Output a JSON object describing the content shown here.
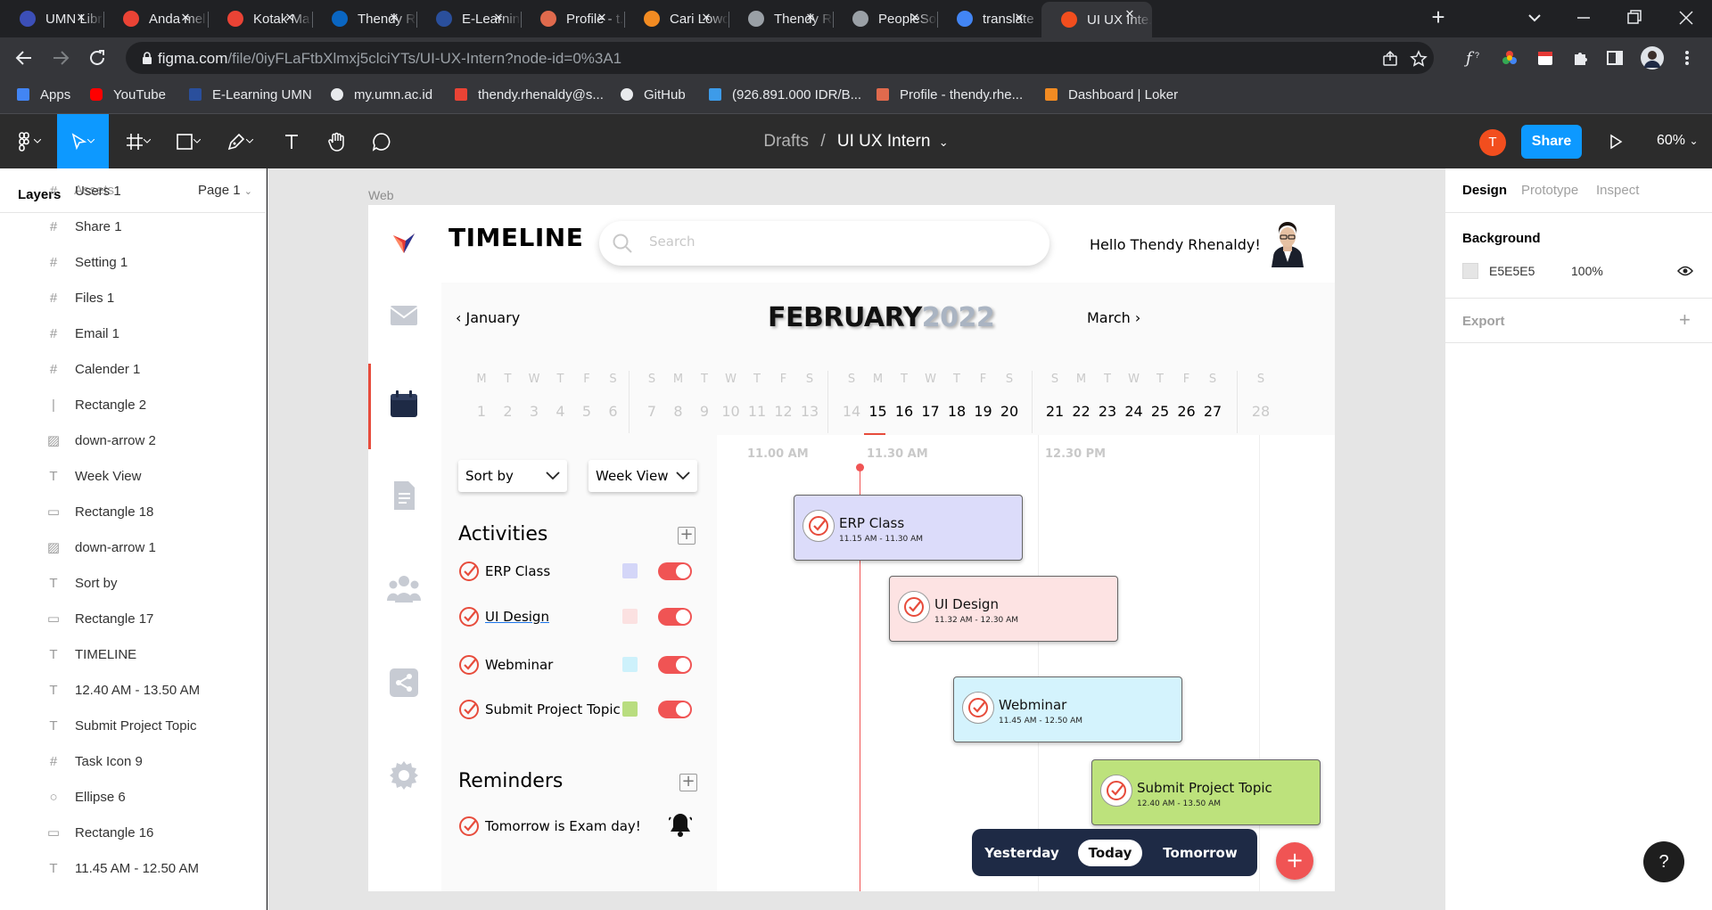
{
  "browser": {
    "tabs": [
      {
        "title": "UMN Library",
        "favicon": "globe-icon",
        "color": "#3c4fb8"
      },
      {
        "title": "Anda mel...",
        "favicon": "gmail-icon",
        "color": "#ea4335"
      },
      {
        "title": "Kotak Ma...",
        "favicon": "gmail-icon",
        "color": "#ea4335"
      },
      {
        "title": "Thendy R...",
        "favicon": "linkedin-icon",
        "color": "#0a66c2"
      },
      {
        "title": "E-Learnin...",
        "favicon": "elearning-icon",
        "color": "#2a4f9c"
      },
      {
        "title": "Profile - t...",
        "favicon": "dots-icon",
        "color": "#e06a4d"
      },
      {
        "title": "Cari Lowo...",
        "favicon": "loker-icon",
        "color": "#f28b22"
      },
      {
        "title": "Thendy R...",
        "favicon": "globe-icon",
        "color": "#9aa0a6"
      },
      {
        "title": "PeopleSo...",
        "favicon": "globe-icon",
        "color": "#9aa0a6"
      },
      {
        "title": "translate",
        "favicon": "google-icon",
        "color": "#4285f4"
      },
      {
        "title": "UI UX Inte...",
        "favicon": "figma-icon",
        "color": "#f24e1e",
        "active": true
      }
    ],
    "url_main": "figma.com",
    "url_rest": "/file/0iyFLaFtbXlmxj5clciYTs/UI-UX-Intern?node-id=0%3A1",
    "bookmarks": [
      {
        "label": "Apps",
        "icon": "apps-grid-icon"
      },
      {
        "label": "YouTube",
        "icon": "youtube-icon"
      },
      {
        "label": "E-Learning UMN",
        "icon": "elearning-icon"
      },
      {
        "label": "my.umn.ac.id",
        "icon": "globe-icon"
      },
      {
        "label": "thendy.rhenaldy@s...",
        "icon": "gmail-icon"
      },
      {
        "label": "GitHub",
        "icon": "github-icon"
      },
      {
        "label": "(926.891.000 IDR/B...",
        "icon": "bitcoin-icon"
      },
      {
        "label": "Profile - thendy.rhe...",
        "icon": "dots-icon"
      },
      {
        "label": "Dashboard | Loker",
        "icon": "loker-icon"
      }
    ]
  },
  "figma": {
    "breadcrumb_parent": "Drafts",
    "breadcrumb_sep": "/",
    "file_name": "UI UX Intern",
    "avatar_initial": "T",
    "share_label": "Share",
    "zoom": "60%",
    "left_tabs": {
      "layers": "Layers",
      "assets": "Assets",
      "page": "Page 1"
    },
    "layers": [
      {
        "name": "Users 1",
        "icon": "frame-icon"
      },
      {
        "name": "Share 1",
        "icon": "frame-icon"
      },
      {
        "name": "Setting 1",
        "icon": "frame-icon"
      },
      {
        "name": "Files 1",
        "icon": "frame-icon"
      },
      {
        "name": "Email 1",
        "icon": "frame-icon"
      },
      {
        "name": "Calender 1",
        "icon": "frame-icon"
      },
      {
        "name": "Rectangle 2",
        "icon": "line-icon"
      },
      {
        "name": "down-arrow 2",
        "icon": "image-icon"
      },
      {
        "name": "Week View",
        "icon": "text-icon"
      },
      {
        "name": "Rectangle 18",
        "icon": "rect-icon"
      },
      {
        "name": "down-arrow 1",
        "icon": "image-icon"
      },
      {
        "name": "Sort by",
        "icon": "text-icon"
      },
      {
        "name": "Rectangle 17",
        "icon": "rect-icon"
      },
      {
        "name": "TIMELINE",
        "icon": "text-icon"
      },
      {
        "name": "12.40 AM - 13.50 AM",
        "icon": "text-icon"
      },
      {
        "name": "Submit Project Topic",
        "icon": "text-icon"
      },
      {
        "name": "Task Icon 9",
        "icon": "frame-icon"
      },
      {
        "name": "Ellipse 6",
        "icon": "ellipse-icon"
      },
      {
        "name": "Rectangle 16",
        "icon": "rect-icon"
      },
      {
        "name": "11.45 AM - 12.50 AM",
        "icon": "text-icon"
      }
    ],
    "right_tabs": {
      "design": "Design",
      "prototype": "Prototype",
      "inspect": "Inspect"
    },
    "background_heading": "Background",
    "background_hex": "E5E5E5",
    "background_opacity": "100%",
    "export_heading": "Export",
    "frame_label": "Web"
  },
  "app": {
    "title": "TIMELINE",
    "search_placeholder": "Search",
    "greeting": "Hello Thendy Rhenaldy!",
    "prev_month": "January",
    "month": "FEBRUARY",
    "year": "2022",
    "next_month": "March",
    "weeks": [
      {
        "days": [
          [
            "M",
            "1"
          ],
          [
            "T",
            "2"
          ],
          [
            "W",
            "3"
          ],
          [
            "T",
            "4"
          ],
          [
            "F",
            "5"
          ],
          [
            "S",
            "6"
          ]
        ]
      },
      {
        "days": [
          [
            "S",
            "7"
          ],
          [
            "M",
            "8"
          ],
          [
            "T",
            "9"
          ],
          [
            "W",
            "10"
          ],
          [
            "T",
            "11"
          ],
          [
            "F",
            "12"
          ],
          [
            "S",
            "13"
          ]
        ]
      },
      {
        "days": [
          [
            "S",
            "14"
          ],
          [
            "M",
            "15"
          ],
          [
            "T",
            "16"
          ],
          [
            "W",
            "17"
          ],
          [
            "T",
            "18"
          ],
          [
            "F",
            "19"
          ],
          [
            "S",
            "20"
          ]
        ]
      },
      {
        "days": [
          [
            "S",
            "21"
          ],
          [
            "M",
            "22"
          ],
          [
            "T",
            "23"
          ],
          [
            "W",
            "24"
          ],
          [
            "T",
            "25"
          ],
          [
            "F",
            "26"
          ],
          [
            "S",
            "27"
          ]
        ]
      },
      {
        "days": [
          [
            "S",
            "28"
          ]
        ]
      }
    ],
    "selected_day": "15",
    "sort_label": "Sort by",
    "view_label": "Week View",
    "activities_heading": "Activities",
    "activities": [
      {
        "name": "ERP Class",
        "color": "#d4d6f8",
        "enabled": true
      },
      {
        "name": "UI Design",
        "color": "#fbe1e1",
        "enabled": true
      },
      {
        "name": "Webminar",
        "color": "#cdf1fb",
        "enabled": true
      },
      {
        "name": "Submit Project Topic",
        "color": "#b9dd7f",
        "enabled": true
      }
    ],
    "reminders_heading": "Reminders",
    "reminders": [
      {
        "text": "Tomorrow is Exam day!"
      }
    ],
    "time_labels": [
      "11.00 AM",
      "11.30 AM",
      "12.30 PM"
    ],
    "events": [
      {
        "title": "ERP Class",
        "time": "11.15 AM - 11.30 AM",
        "color": "#dcdcfa"
      },
      {
        "title": "UI Design",
        "time": "11.32 AM - 12.30 AM",
        "color": "#fde3e3"
      },
      {
        "title": "Webminar",
        "time": "11.45 AM - 12.50 AM",
        "color": "#d4f3fd"
      },
      {
        "title": "Submit Project Topic",
        "time": "12.40 AM - 13.50 AM",
        "color": "#bde27c"
      }
    ],
    "day_switch": [
      "Yesterday",
      "Today",
      "Tomorrow"
    ],
    "day_switch_active": "Today",
    "fab_label": "+",
    "accent_color": "#f05454"
  },
  "help_label": "?"
}
